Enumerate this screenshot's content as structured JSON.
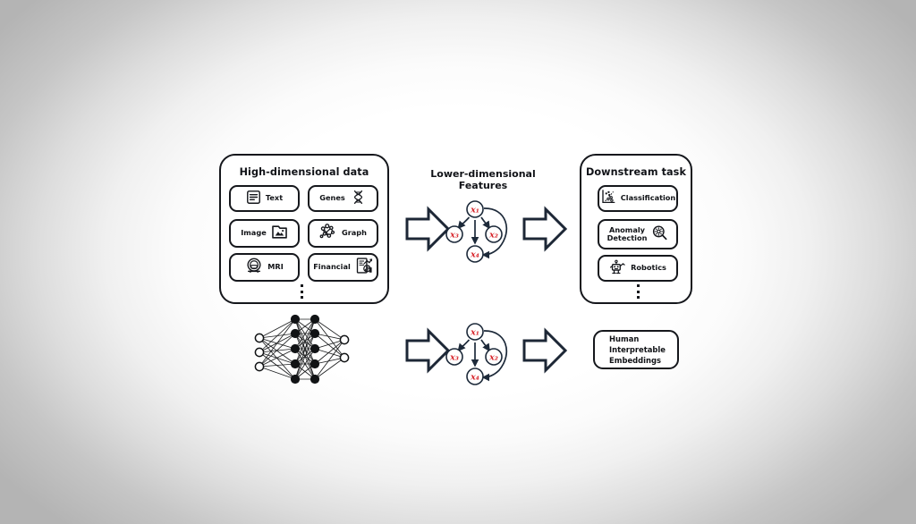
{
  "figure": {
    "background_edge_color": "#b4b4b4",
    "background_center_color": "#ffffff",
    "ink_color": "#15171c",
    "arrow_color": "#1d2736",
    "node_fill": "#ffffff",
    "node_stroke": "#1d2a3a",
    "node_label_color": "#d7262c"
  },
  "left_panel": {
    "title": "High-dimensional data",
    "items": [
      {
        "label": "Text",
        "icon": "document-lines-icon",
        "icon_side": "left"
      },
      {
        "label": "Genes",
        "icon": "dna-helix-icon",
        "icon_side": "right"
      },
      {
        "label": "Image",
        "icon": "image-folder-icon",
        "icon_side": "right"
      },
      {
        "label": "Graph",
        "icon": "molecule-graph-icon",
        "icon_side": "left"
      },
      {
        "label": "MRI",
        "icon": "mri-scanner-icon",
        "icon_side": "left"
      },
      {
        "label": "Financial",
        "icon": "financial-chart-icon",
        "icon_side": "right"
      }
    ],
    "more_indicator": "vertical-ellipsis"
  },
  "middle_top": {
    "caption": "Lower-dimensional\nFeatures",
    "graph": {
      "nodes": [
        {
          "id": "x1",
          "label": "x₁"
        },
        {
          "id": "x2",
          "label": "x₂"
        },
        {
          "id": "x3",
          "label": "x₃"
        },
        {
          "id": "x4",
          "label": "x₄"
        }
      ],
      "edges": [
        {
          "from": "x1",
          "to": "x3"
        },
        {
          "from": "x1",
          "to": "x2"
        },
        {
          "from": "x1",
          "to": "x4"
        },
        {
          "from": "x1",
          "to": "x4",
          "style": "curved"
        }
      ]
    }
  },
  "middle_bottom": {
    "graph": {
      "nodes": [
        {
          "id": "x1",
          "label": "x₁"
        },
        {
          "id": "x2",
          "label": "x₂"
        },
        {
          "id": "x3",
          "label": "x₃"
        },
        {
          "id": "x4",
          "label": "x₄"
        }
      ],
      "edges": [
        {
          "from": "x1",
          "to": "x3"
        },
        {
          "from": "x1",
          "to": "x2"
        },
        {
          "from": "x1",
          "to": "x4"
        },
        {
          "from": "x1",
          "to": "x4",
          "style": "curved"
        }
      ]
    }
  },
  "right_panel": {
    "title": "Downstream task",
    "items": [
      {
        "label": "Classification",
        "icon": "scatter-classify-icon",
        "icon_side": "left"
      },
      {
        "label": "Anomaly\nDetection",
        "icon": "magnifier-gear-icon",
        "icon_side": "right"
      },
      {
        "label": "Robotics",
        "icon": "robot-icon",
        "icon_side": "left"
      }
    ],
    "more_indicator": "vertical-ellipsis"
  },
  "embedding_box": {
    "text": "Human\nInterpretable\nEmbeddings"
  },
  "neural_network": {
    "name": "neural-network-diagram",
    "layers": [
      3,
      5,
      5,
      2
    ],
    "input_node_style": "hollow",
    "hidden_node_style": "filled",
    "output_node_style": "hollow"
  },
  "arrows": [
    {
      "name": "arrow-data-to-features-top",
      "direction": "right"
    },
    {
      "name": "arrow-features-to-task-top",
      "direction": "right"
    },
    {
      "name": "arrow-network-to-features-bottom",
      "direction": "right"
    },
    {
      "name": "arrow-features-to-embeddings",
      "direction": "right"
    }
  ]
}
